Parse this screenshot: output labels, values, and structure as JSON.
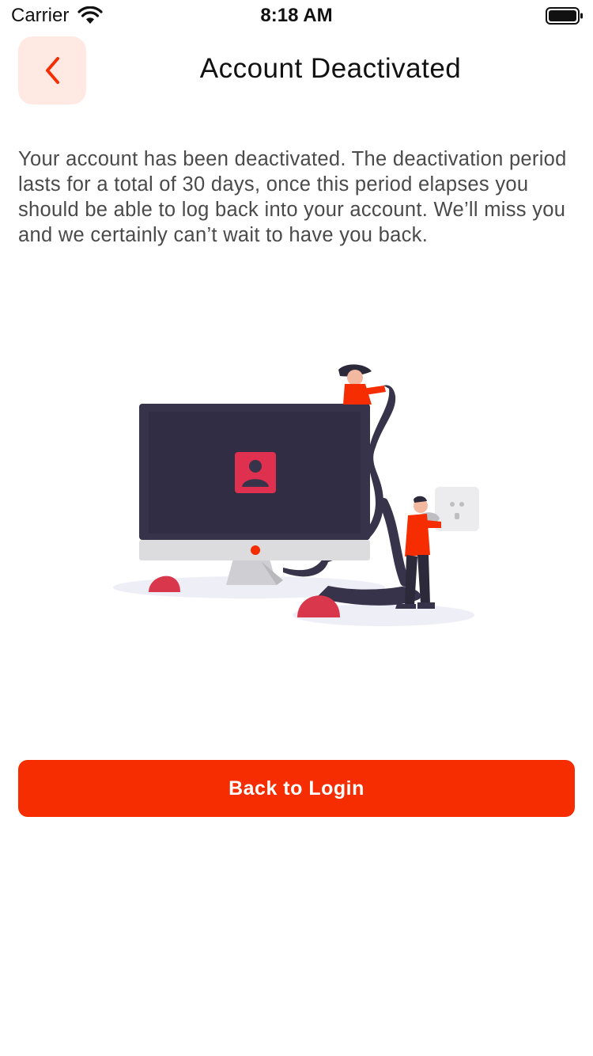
{
  "status_bar": {
    "carrier": "Carrier",
    "time": "8:18 AM"
  },
  "header": {
    "title": "Account Deactivated",
    "back_icon": "chevron-left-icon"
  },
  "main": {
    "message": "Your account has been deactivated. The deactivation period lasts for a total of 30 days, once this period elapses you should be able to log back into your account. We’ll miss you and we certainly can’t wait to have you back.",
    "illustration": "monitor-unplugged-illustration",
    "login_button_label": "Back to Login"
  },
  "colors": {
    "accent": "#f62d00",
    "back_button_bg": "#ffe9e2",
    "monitor_dark": "#36334a",
    "icon_pink": "#e0304f",
    "text_body": "#4a4a4a"
  }
}
